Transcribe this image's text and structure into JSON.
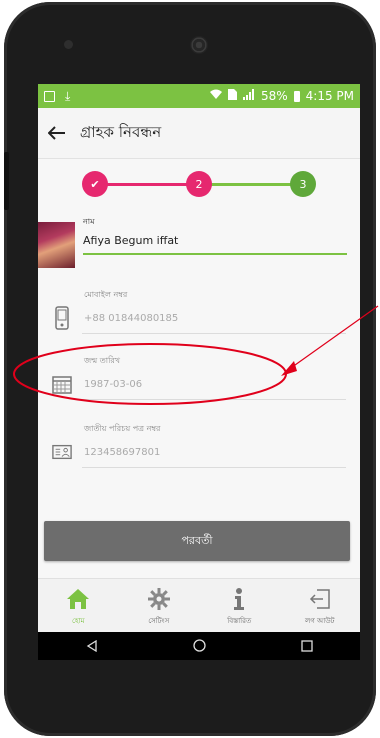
{
  "status_bar": {
    "battery": "58%",
    "time": "4:15 PM"
  },
  "appbar": {
    "title": "গ্রাহক নিবন্ধন"
  },
  "stepper": {
    "steps": [
      {
        "label": "✔",
        "state": "done"
      },
      {
        "label": "2",
        "state": "active"
      },
      {
        "label": "3",
        "state": "current"
      }
    ]
  },
  "form": {
    "name": {
      "label": "নাম",
      "value": "Afiya Begum iffat"
    },
    "mobile": {
      "label": "মোবাইল নম্বর",
      "value": "+88 01844080185",
      "icon": "phone-icon"
    },
    "dob": {
      "label": "জন্ম তারিখ",
      "value": "1987-03-06",
      "icon": "calendar-icon"
    },
    "nid": {
      "label": "জাতীয় পরিচয় পত্র নম্বর",
      "value": "123458697801",
      "icon": "id-card-icon"
    }
  },
  "next_button": {
    "label": "পরবর্তী"
  },
  "bottom_nav": {
    "items": [
      {
        "label": "হোম",
        "icon": "home-icon",
        "active": true
      },
      {
        "label": "সেটিংস",
        "icon": "gear-icon",
        "active": false
      },
      {
        "label": "বিস্তারিত",
        "icon": "info-icon",
        "active": false
      },
      {
        "label": "লগ আউট",
        "icon": "logout-icon",
        "active": false
      }
    ]
  },
  "colors": {
    "accent_green": "#7cc242",
    "accent_pink": "#e6286f",
    "annotation_red": "#e0001b"
  }
}
